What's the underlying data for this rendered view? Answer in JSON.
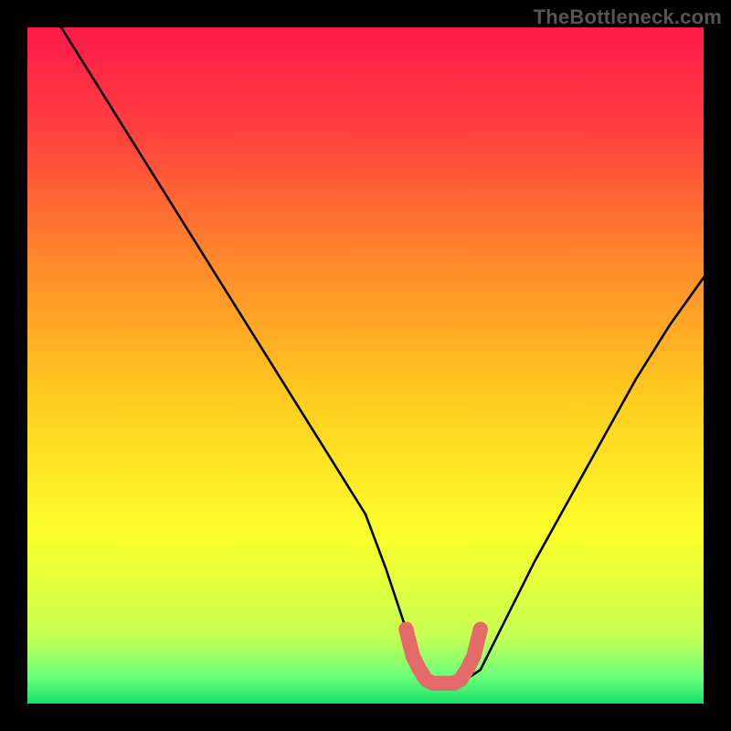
{
  "watermark": "TheBottleneck.com",
  "chart_data": {
    "type": "line",
    "title": "",
    "xlabel": "",
    "ylabel": "",
    "xlim": [
      0,
      100
    ],
    "ylim": [
      0,
      100
    ],
    "grid": false,
    "legend": false,
    "series": [
      {
        "name": "bottleneck-curve",
        "x": [
          5,
          10,
          15,
          20,
          25,
          30,
          35,
          40,
          45,
          50,
          53,
          56,
          58,
          60,
          62,
          64,
          67,
          70,
          75,
          80,
          85,
          90,
          95,
          100
        ],
        "y": [
          100,
          92,
          84,
          76,
          68,
          60,
          52,
          44,
          36,
          28,
          20,
          11,
          5,
          3,
          3,
          3,
          5,
          11,
          21,
          30,
          39,
          48,
          56,
          63
        ]
      },
      {
        "name": "optimal-zone-marker",
        "x": [
          56,
          57,
          58,
          59,
          60,
          61,
          62,
          63,
          64,
          65,
          66,
          67
        ],
        "y": [
          11,
          7,
          5,
          3.5,
          3,
          3,
          3,
          3,
          3.5,
          5,
          7,
          11
        ]
      }
    ],
    "gradient_stops": [
      {
        "pos": 0.0,
        "color": "#ff1a4b"
      },
      {
        "pos": 0.15,
        "color": "#ff3f3f"
      },
      {
        "pos": 0.35,
        "color": "#ff8a2a"
      },
      {
        "pos": 0.55,
        "color": "#ffcc1f"
      },
      {
        "pos": 0.75,
        "color": "#fbff2a"
      },
      {
        "pos": 0.9,
        "color": "#c7ff52"
      },
      {
        "pos": 0.96,
        "color": "#6cff7a"
      },
      {
        "pos": 1.0,
        "color": "#17e06a"
      }
    ],
    "marker_color": "#e46a6a",
    "curve_color": "#000000"
  }
}
